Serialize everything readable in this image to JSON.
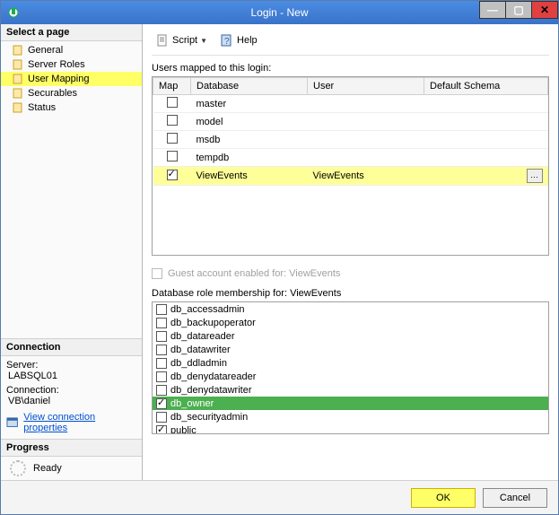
{
  "window": {
    "title": "Login - New"
  },
  "sidebar": {
    "heading": "Select a page",
    "pages": [
      {
        "label": "General",
        "selected": false
      },
      {
        "label": "Server Roles",
        "selected": false
      },
      {
        "label": "User Mapping",
        "selected": true
      },
      {
        "label": "Securables",
        "selected": false
      },
      {
        "label": "Status",
        "selected": false
      }
    ]
  },
  "connection": {
    "heading": "Connection",
    "server_label": "Server:",
    "server_value": "LABSQL01",
    "conn_label": "Connection:",
    "conn_value": "VB\\daniel",
    "link_text": "View connection properties"
  },
  "progress": {
    "heading": "Progress",
    "status": "Ready"
  },
  "toolbar": {
    "script_label": "Script",
    "help_label": "Help"
  },
  "mapping": {
    "label": "Users mapped to this login:",
    "headers": {
      "map": "Map",
      "database": "Database",
      "user": "User",
      "schema": "Default Schema"
    },
    "rows": [
      {
        "checked": false,
        "database": "master",
        "user": "",
        "schema": "",
        "selected": false
      },
      {
        "checked": false,
        "database": "model",
        "user": "",
        "schema": "",
        "selected": false
      },
      {
        "checked": false,
        "database": "msdb",
        "user": "",
        "schema": "",
        "selected": false
      },
      {
        "checked": false,
        "database": "tempdb",
        "user": "",
        "schema": "",
        "selected": false
      },
      {
        "checked": true,
        "database": "ViewEvents",
        "user": "ViewEvents",
        "schema": "",
        "selected": true
      }
    ]
  },
  "guest": {
    "label": "Guest account enabled for: ViewEvents"
  },
  "roles": {
    "label": "Database role membership for: ViewEvents",
    "items": [
      {
        "name": "db_accessadmin",
        "checked": false,
        "selected": false
      },
      {
        "name": "db_backupoperator",
        "checked": false,
        "selected": false
      },
      {
        "name": "db_datareader",
        "checked": false,
        "selected": false
      },
      {
        "name": "db_datawriter",
        "checked": false,
        "selected": false
      },
      {
        "name": "db_ddladmin",
        "checked": false,
        "selected": false
      },
      {
        "name": "db_denydatareader",
        "checked": false,
        "selected": false
      },
      {
        "name": "db_denydatawriter",
        "checked": false,
        "selected": false
      },
      {
        "name": "db_owner",
        "checked": true,
        "selected": true,
        "highlight": true
      },
      {
        "name": "db_securityadmin",
        "checked": false,
        "selected": false
      },
      {
        "name": "public",
        "checked": true,
        "selected": false
      }
    ]
  },
  "footer": {
    "ok": "OK",
    "cancel": "Cancel"
  }
}
